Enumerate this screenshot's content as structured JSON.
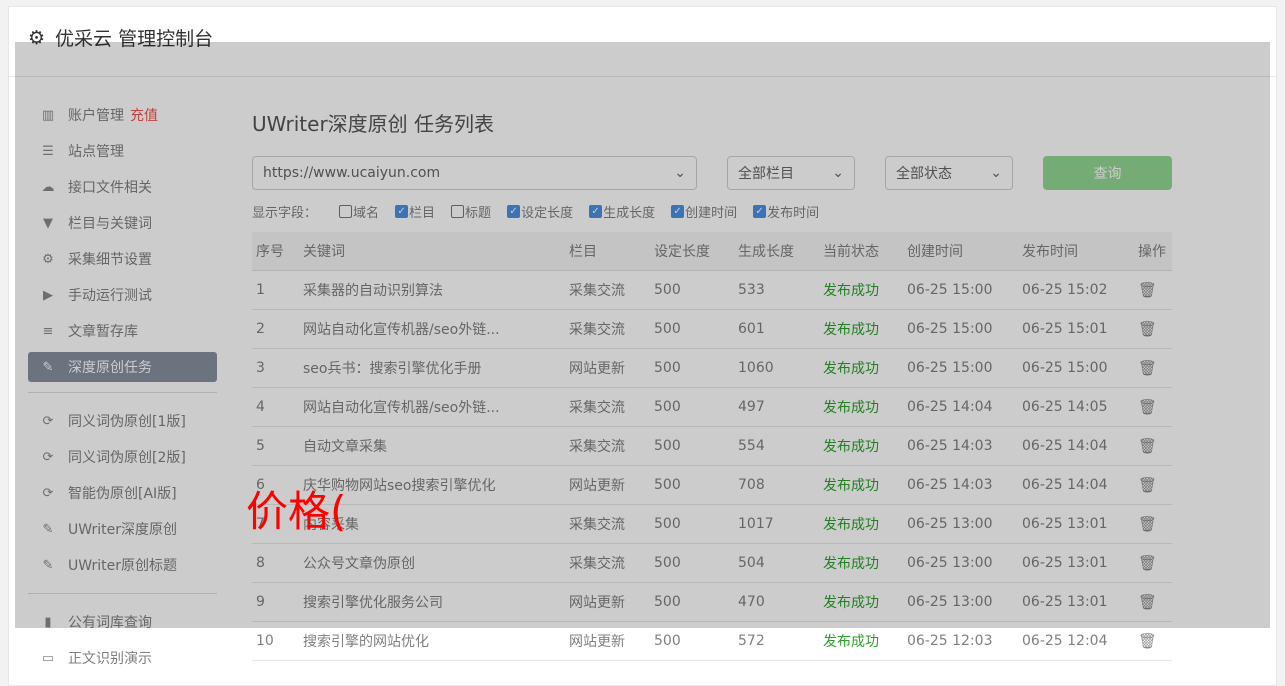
{
  "header": {
    "title": "优采云 管理控制台"
  },
  "sidebar": {
    "items": [
      {
        "label": "账户管理",
        "extra": "充值",
        "icon": "bar-chart-icon"
      },
      {
        "label": "站点管理",
        "icon": "server-icon"
      },
      {
        "label": "接口文件相关",
        "icon": "cloud-upload-icon"
      },
      {
        "label": "栏目与关键词",
        "icon": "filter-icon"
      },
      {
        "label": "采集细节设置",
        "icon": "gears-icon"
      },
      {
        "label": "手动运行测试",
        "icon": "play-icon"
      },
      {
        "label": "文章暂存库",
        "icon": "database-icon"
      },
      {
        "label": "深度原创任务",
        "icon": "edit-icon",
        "active": true
      },
      {
        "label": "同义词伪原创[1版]",
        "icon": "refresh-icon"
      },
      {
        "label": "同义词伪原创[2版]",
        "icon": "refresh-icon"
      },
      {
        "label": "智能伪原创[AI版]",
        "icon": "refresh-icon"
      },
      {
        "label": "UWriter深度原创",
        "icon": "edit-icon"
      },
      {
        "label": "UWriter原创标题",
        "icon": "edit-icon"
      },
      {
        "label": "公有词库查询",
        "icon": "book-icon"
      },
      {
        "label": "正文识别演示",
        "icon": "monitor-icon"
      }
    ]
  },
  "main": {
    "title": "UWriter深度原创 任务列表",
    "site_select": "https://www.ucaiyun.com",
    "column_select": "全部栏目",
    "status_select": "全部状态",
    "query_button": "查询",
    "fields_label": "显示字段：",
    "fields": [
      {
        "label": "域名",
        "checked": false
      },
      {
        "label": "栏目",
        "checked": true
      },
      {
        "label": "标题",
        "checked": false
      },
      {
        "label": "设定长度",
        "checked": true
      },
      {
        "label": "生成长度",
        "checked": true
      },
      {
        "label": "创建时间",
        "checked": true
      },
      {
        "label": "发布时间",
        "checked": true
      }
    ],
    "columns": [
      "序号",
      "关键词",
      "栏目",
      "设定长度",
      "生成长度",
      "当前状态",
      "创建时间",
      "发布时间",
      "操作"
    ],
    "rows": [
      [
        "1",
        "采集器的自动识别算法",
        "采集交流",
        "500",
        "533",
        "发布成功",
        "06-25 15:00",
        "06-25 15:02"
      ],
      [
        "2",
        "网站自动化宣传机器/seo外链...",
        "采集交流",
        "500",
        "601",
        "发布成功",
        "06-25 15:00",
        "06-25 15:01"
      ],
      [
        "3",
        "seo兵书：搜索引擎优化手册",
        "网站更新",
        "500",
        "1060",
        "发布成功",
        "06-25 15:00",
        "06-25 15:00"
      ],
      [
        "4",
        "网站自动化宣传机器/seo外链...",
        "采集交流",
        "500",
        "497",
        "发布成功",
        "06-25 14:04",
        "06-25 14:05"
      ],
      [
        "5",
        "自动文章采集",
        "采集交流",
        "500",
        "554",
        "发布成功",
        "06-25 14:03",
        "06-25 14:04"
      ],
      [
        "6",
        "庆华购物网站seo搜索引擎优化",
        "网站更新",
        "500",
        "708",
        "发布成功",
        "06-25 14:03",
        "06-25 14:04"
      ],
      [
        "7",
        "内容采集",
        "采集交流",
        "500",
        "1017",
        "发布成功",
        "06-25 13:00",
        "06-25 13:01"
      ],
      [
        "8",
        "公众号文章伪原创",
        "采集交流",
        "500",
        "504",
        "发布成功",
        "06-25 13:00",
        "06-25 13:01"
      ],
      [
        "9",
        "搜索引擎优化服务公司",
        "网站更新",
        "500",
        "470",
        "发布成功",
        "06-25 13:00",
        "06-25 13:01"
      ],
      [
        "10",
        "搜索引擎的网站优化",
        "网站更新",
        "500",
        "572",
        "发布成功",
        "06-25 12:03",
        "06-25 12:04"
      ]
    ]
  },
  "overlay_text": "价格("
}
